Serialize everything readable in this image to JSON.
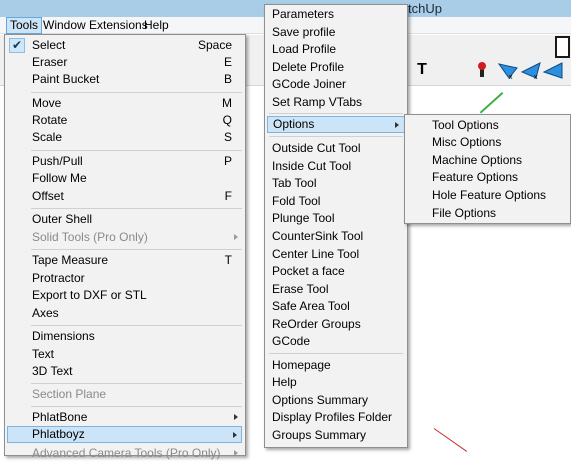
{
  "window": {
    "title_fragment": "tchUp"
  },
  "menubar": {
    "items": [
      {
        "label": "Tools",
        "active": true
      },
      {
        "label": "Window"
      },
      {
        "label": "Extensions"
      },
      {
        "label": "Help"
      }
    ]
  },
  "toolbar": {
    "text_tool_glyph": "T"
  },
  "tools_menu": {
    "items": [
      {
        "label": "Select",
        "shortcut": "Space",
        "checked": true
      },
      {
        "label": "Eraser",
        "shortcut": "E"
      },
      {
        "label": "Paint Bucket",
        "shortcut": "B"
      },
      {
        "label": "Move",
        "shortcut": "M"
      },
      {
        "label": "Rotate",
        "shortcut": "Q"
      },
      {
        "label": "Scale",
        "shortcut": "S"
      },
      {
        "label": "Push/Pull",
        "shortcut": "P"
      },
      {
        "label": "Follow Me",
        "shortcut": ""
      },
      {
        "label": "Offset",
        "shortcut": "F"
      },
      {
        "label": "Outer Shell",
        "shortcut": ""
      },
      {
        "label": "Solid Tools (Pro Only)",
        "shortcut": "",
        "submenu": true,
        "disabled": true
      },
      {
        "label": "Tape Measure",
        "shortcut": "T"
      },
      {
        "label": "Protractor",
        "shortcut": ""
      },
      {
        "label": "Export to DXF or STL",
        "shortcut": ""
      },
      {
        "label": "Axes",
        "shortcut": ""
      },
      {
        "label": "Dimensions",
        "shortcut": ""
      },
      {
        "label": "Text",
        "shortcut": ""
      },
      {
        "label": "3D Text",
        "shortcut": ""
      },
      {
        "label": "Section Plane",
        "shortcut": "",
        "disabled": true
      },
      {
        "label": "PhlatBone",
        "shortcut": "",
        "submenu": true
      },
      {
        "label": "Phlatboyz",
        "shortcut": "",
        "submenu": true,
        "highlighted": true
      },
      {
        "label": "Advanced Camera Tools (Pro Only)",
        "shortcut": "",
        "submenu": true,
        "disabled": true
      }
    ]
  },
  "phlatboyz_menu": {
    "items": [
      {
        "label": "Parameters"
      },
      {
        "label": "Save profile"
      },
      {
        "label": "Load Profile"
      },
      {
        "label": "Delete Profile"
      },
      {
        "label": "GCode Joiner"
      },
      {
        "label": "Set Ramp VTabs"
      },
      {
        "label": "Options",
        "submenu": true,
        "highlighted": true
      },
      {
        "label": "Outside Cut Tool"
      },
      {
        "label": "Inside Cut Tool"
      },
      {
        "label": "Tab Tool"
      },
      {
        "label": "Fold Tool"
      },
      {
        "label": "Plunge Tool"
      },
      {
        "label": "CounterSink Tool"
      },
      {
        "label": "Center Line Tool"
      },
      {
        "label": "Pocket a face"
      },
      {
        "label": "Erase Tool"
      },
      {
        "label": "Safe Area Tool"
      },
      {
        "label": "ReOrder Groups"
      },
      {
        "label": "GCode"
      },
      {
        "label": "Homepage"
      },
      {
        "label": "Help"
      },
      {
        "label": "Options Summary"
      },
      {
        "label": "Display Profiles Folder"
      },
      {
        "label": "Groups Summary"
      }
    ]
  },
  "options_menu": {
    "items": [
      {
        "label": "Tool Options"
      },
      {
        "label": "Misc Options"
      },
      {
        "label": "Machine Options"
      },
      {
        "label": "Feature Options"
      },
      {
        "label": "Hole Feature Options"
      },
      {
        "label": "File Options"
      }
    ]
  },
  "colors": {
    "highlight": "#cce4f7",
    "highlight_border": "#7fb4e0",
    "menu_bg": "#f2f2f2",
    "titlebar": "#a9cde6"
  }
}
